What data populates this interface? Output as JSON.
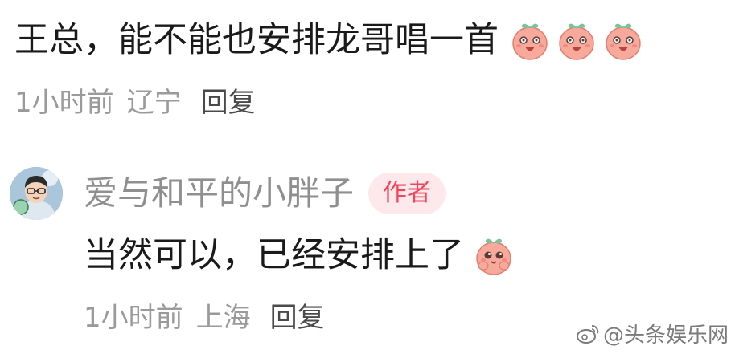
{
  "comment": {
    "text": "王总，能不能也安排龙哥唱一首",
    "time": "1小时前",
    "location": "辽宁",
    "reply_label": "回复",
    "emoji_count": 3
  },
  "reply": {
    "username": "爱与和平的小胖子",
    "author_badge": "作者",
    "text": "当然可以，已经安排上了",
    "time": "1小时前",
    "location": "上海",
    "reply_label": "回复"
  },
  "watermark": {
    "text": "@头条娱乐网"
  },
  "colors": {
    "text_primary": "#1a1a1a",
    "text_meta": "#9a9a9a",
    "badge_bg": "#fde8eb",
    "badge_text": "#f0455a",
    "emoji_skin": "#f7a99b"
  }
}
